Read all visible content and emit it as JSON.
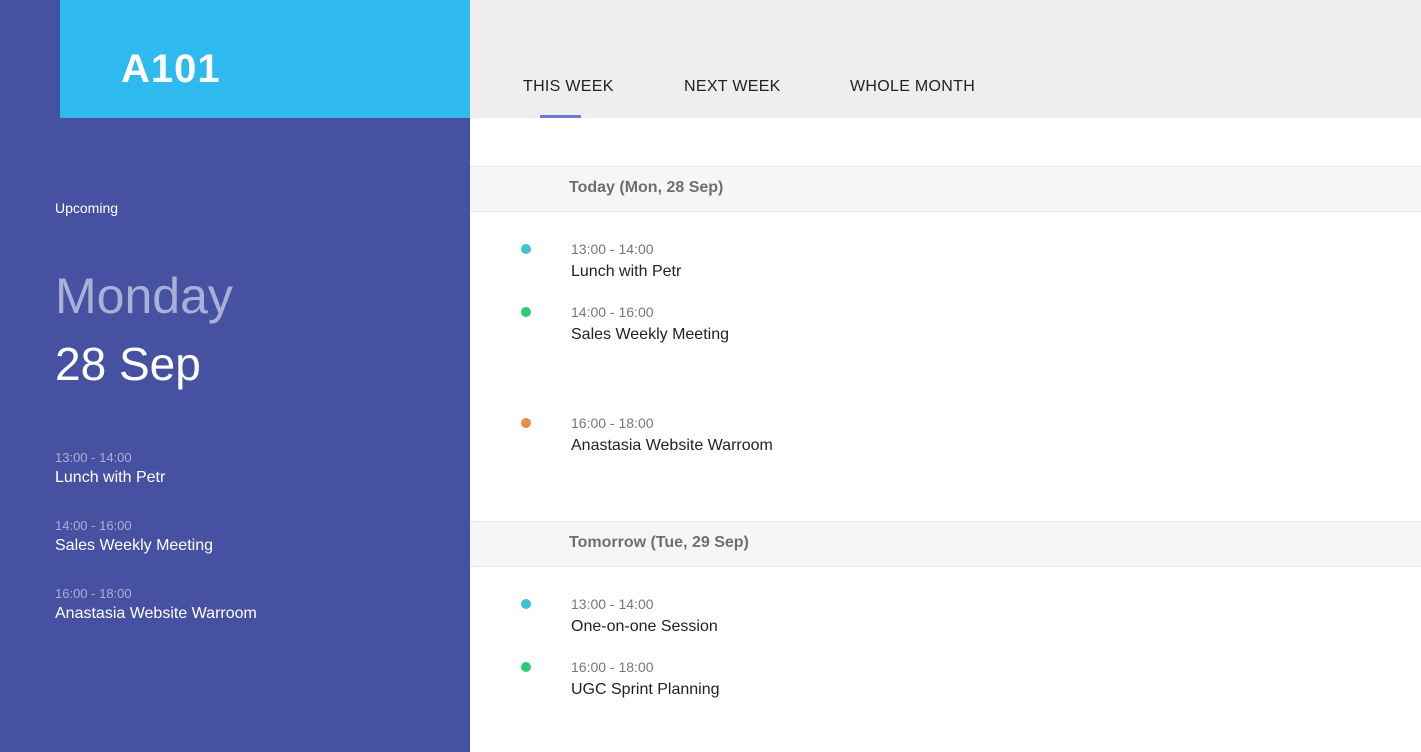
{
  "room": {
    "name": "A101"
  },
  "sidebar": {
    "upcoming_label": "Upcoming",
    "day_name": "Monday",
    "date": "28 Sep",
    "events": [
      {
        "time": "13:00 - 14:00",
        "title": "Lunch with Petr"
      },
      {
        "time": "14:00 - 16:00",
        "title": "Sales Weekly Meeting"
      },
      {
        "time": "16:00 - 18:00",
        "title": "Anastasia Website Warroom"
      }
    ]
  },
  "tabs": [
    {
      "label": "THIS WEEK",
      "active": true
    },
    {
      "label": "NEXT WEEK",
      "active": false
    },
    {
      "label": "WHOLE MONTH",
      "active": false
    }
  ],
  "schedule": {
    "days": [
      {
        "header": "Today (Mon, 28 Sep)",
        "events": [
          {
            "time": "13:00 - 14:00",
            "title": "Lunch with Petr",
            "color": "#3ec1d3"
          },
          {
            "time": "14:00 - 16:00",
            "title": "Sales Weekly Meeting",
            "color": "#2ecc71"
          },
          {
            "time": "16:00 - 18:00",
            "title": "Anastasia Website Warroom",
            "color": "#f08a4b"
          }
        ]
      },
      {
        "header": "Tomorrow (Tue, 29 Sep)",
        "events": [
          {
            "time": "13:00 - 14:00",
            "title": "One-on-one Session",
            "color": "#3ec1d3"
          },
          {
            "time": "16:00 - 18:00",
            "title": "UGC Sprint Planning",
            "color": "#2ecc71"
          }
        ]
      }
    ]
  },
  "colors": {
    "sidebar_bg": "#4652a1",
    "header_bg": "#2fbaef",
    "tab_indicator": "#6f79d1",
    "tabbar_bg": "#efeeec"
  }
}
